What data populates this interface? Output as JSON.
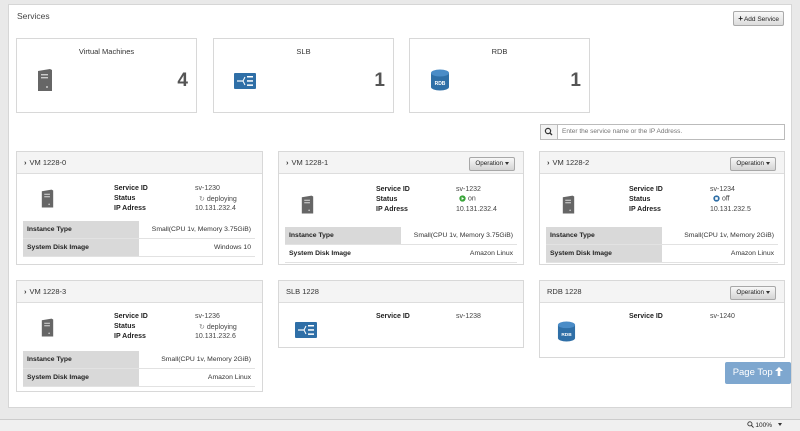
{
  "page": {
    "title": "Services",
    "add_button": "Add Service"
  },
  "summary": [
    {
      "label": "Virtual Machines",
      "count": "4",
      "icon": "server-icon"
    },
    {
      "label": "SLB",
      "count": "1",
      "icon": "load-balancer-icon"
    },
    {
      "label": "RDB",
      "count": "1",
      "icon": "database-icon"
    }
  ],
  "search": {
    "placeholder": "Enter the service name or the IP Address."
  },
  "labels": {
    "service_id": "Service ID",
    "status": "Status",
    "ip_address": "IP Adress",
    "instance_type": "Instance Type",
    "disk_image": "System Disk Image",
    "operation": "Operation"
  },
  "cards": [
    {
      "title": "VM 1228-0",
      "service_id": "sv-1230",
      "status": "deploying",
      "ip": "10.131.232.4",
      "instance_type": "Small(CPU 1v, Memory 3.75GiB)",
      "disk_image": "Windows 10"
    },
    {
      "title": "VM 1228-1",
      "service_id": "sv-1232",
      "status": "on",
      "ip": "10.131.232.4",
      "instance_type": "Small(CPU 1v, Memory 3.75GiB)",
      "disk_image": "Amazon Linux"
    },
    {
      "title": "VM 1228-2",
      "service_id": "sv-1234",
      "status": "off",
      "ip": "10.131.232.5",
      "instance_type": "Small(CPU 1v, Memory 2GiB)",
      "disk_image": "Amazon Linux"
    },
    {
      "title": "VM 1228-3",
      "service_id": "sv-1236",
      "status": "deploying",
      "ip": "10.131.232.6",
      "instance_type": "Small(CPU 1v, Memory 2GiB)",
      "disk_image": "Amazon Linux"
    },
    {
      "title": "SLB 1228",
      "service_id": "sv-1238"
    },
    {
      "title": "RDB 1228",
      "service_id": "sv-1240"
    }
  ],
  "page_top": "Page Top",
  "status_bar": {
    "zoom": "100%"
  },
  "colors": {
    "accent_blue": "#2f6fa7",
    "status_on": "#3aa53a",
    "status_off": "#2f6fa7",
    "page_top": "#7ea7cf"
  }
}
